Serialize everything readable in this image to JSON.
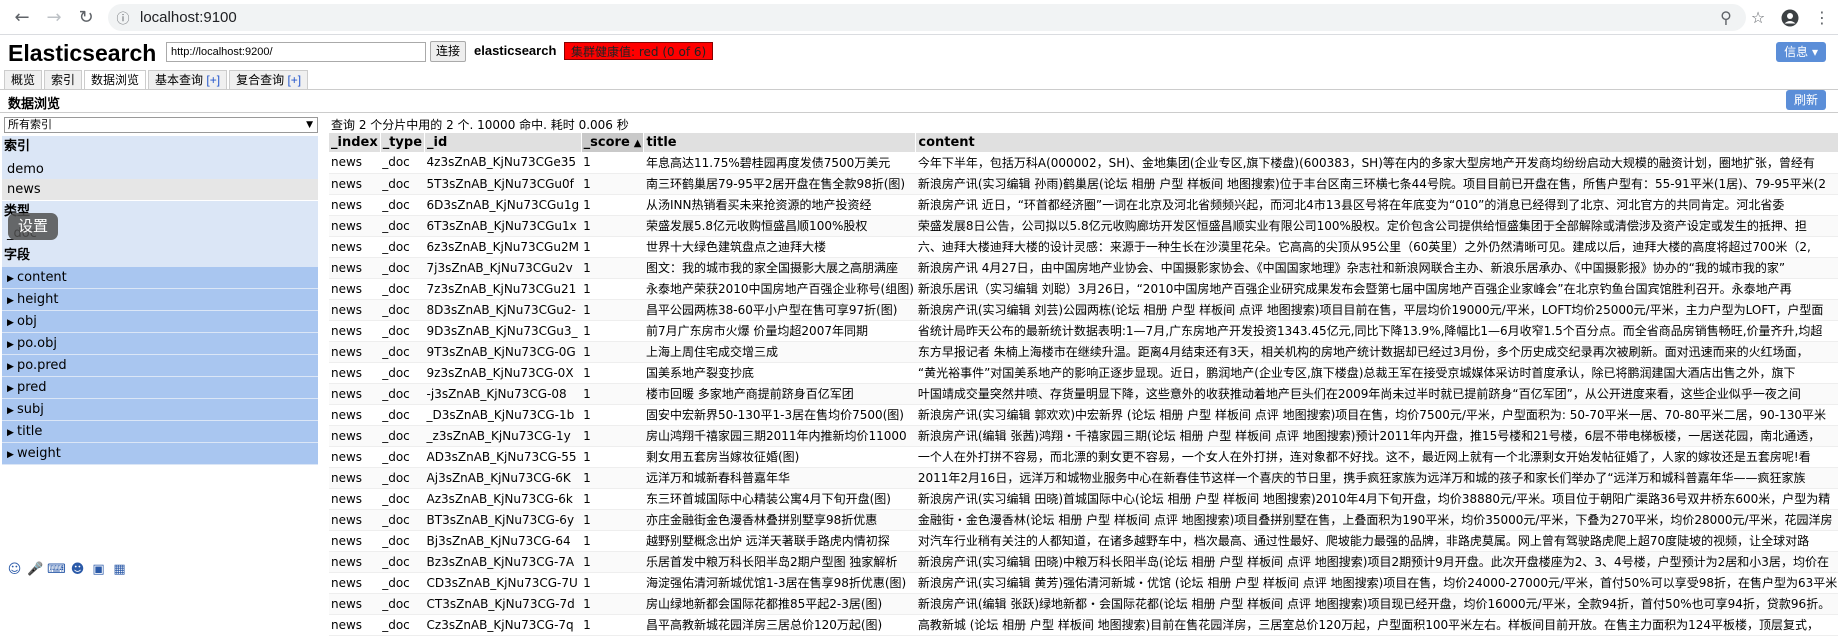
{
  "browser": {
    "url": "localhost:9100"
  },
  "header": {
    "app_title": "Elasticsearch",
    "cluster_url": "http://localhost:9200/",
    "connect_label": "连接",
    "cluster_name": "elasticsearch",
    "health_label": "集群健康值: red (0 of 6)",
    "info_label": "信息 ▾"
  },
  "tabs": [
    {
      "label": "概览",
      "plus": ""
    },
    {
      "label": "索引",
      "plus": ""
    },
    {
      "label": "数据浏览",
      "plus": ""
    },
    {
      "label": "基本查询",
      "plus": "[+]"
    },
    {
      "label": "复合查询",
      "plus": "[+]"
    }
  ],
  "toolbar": {
    "section_title": "数据浏览",
    "refresh_label": "刷新"
  },
  "sidebar": {
    "index_select": "所有索引",
    "index_heading": "索引",
    "indices": [
      "demo",
      "news"
    ],
    "type_heading": "类型",
    "types": [
      "_doc"
    ],
    "field_heading": "字段",
    "fields": [
      "content",
      "height",
      "obj",
      "po.obj",
      "po.pred",
      "pred",
      "subj",
      "title",
      "weight"
    ],
    "tooltip": "设置"
  },
  "results": {
    "summary": "查询 2 个分片中用的 2 个. 10000 命中. 耗时 0.006 秒",
    "columns": [
      "_index",
      "_type",
      "_id",
      "_score",
      "title",
      "content"
    ],
    "rows": [
      [
        "news",
        "_doc",
        "4z3sZnAB_KjNu73CGe35",
        "1",
        "年息高达11.75%碧桂园再度发债7500万美元",
        "今年下半年，包括万科A(000002，SH)、金地集团(企业专区,旗下楼盘)(600383，SH)等在内的多家大型房地产开发商均纷纷启动大规模的融资计划，圈地扩张，曾经有"
      ],
      [
        "news",
        "_doc",
        "5T3sZnAB_KjNu73CGu0f",
        "1",
        "南三环鹤巢居79-95平2居开盘在售全款98折(图)",
        "新浪房产讯(实习编辑 孙雨)鹤巢居(论坛 相册 户型 样板间 地图搜索)位于丰台区南三环横七条44号院。项目目前已开盘在售，所售户型有：55-91平米(1居)、79-95平米(2"
      ],
      [
        "news",
        "_doc",
        "6D3sZnAB_KjNu73CGu1g",
        "1",
        "从汤INN热销看买未来抢资源的地产投资经",
        "新浪房产讯 近日，“环首都经济圈”一词在北京及河北省频频兴起，而河北4市13县区号将在年底变为“010”的消息已经得到了北京、河北官方的共同肯定。河北省委"
      ],
      [
        "news",
        "_doc",
        "6T3sZnAB_KjNu73CGu1x",
        "1",
        "荣盛发展5.8亿元收购恒盛昌顺100%股权",
        "荣盛发展8日公告，公司拟以5.8亿元收购廊坊开发区恒盛昌顺实业有限公司100%股权。定价包含公司提供给恒盛集团于全部解除或清偿涉及资产设定或发生的抵押、担"
      ],
      [
        "news",
        "_doc",
        "6z3sZnAB_KjNu73CGu2M",
        "1",
        "世界十大绿色建筑盘点之迪拜大楼",
        "六、迪拜大楼迪拜大楼的设计灵感：来源于一种生长在沙漠里花朵。它高高的尖顶从95公里（60英里）之外仍然清晰可见。建成以后，迪拜大楼的高度将超过700米（2,"
      ],
      [
        "news",
        "_doc",
        "7j3sZnAB_KjNu73CGu2v",
        "1",
        "图文：我的城市我的家全国摄影大展之高朋满座",
        "新浪房产讯 4月27日，由中国房地产业协会、中国摄影家协会、《中国国家地理》杂志社和新浪网联合主办、新浪乐居承办、《中国摄影报》协办的“我的城市我的家”"
      ],
      [
        "news",
        "_doc",
        "7z3sZnAB_KjNu73CGu21",
        "1",
        "永泰地产荣获2010中国房地产百强企业称号(组图)",
        "新浪乐居讯（实习编辑 刘聪）3月26日，“2010中国房地产百强企业研究成果发布会暨第七届中国房地产百强企业家峰会”在北京钓鱼台国宾馆胜利召开。永泰地产再"
      ],
      [
        "news",
        "_doc",
        "8D3sZnAB_KjNu73CGu2-",
        "1",
        "昌平公园两栋38-60平小户型在售可享97折(图)",
        "新浪房产讯(实习编辑 刘芸)公园两栋(论坛 相册 户型 样板间 点评 地图搜索)项目目前在售，平层均价19000元/平米，LOFT均价25000元/平米，主力户型为LOFT，户型面"
      ],
      [
        "news",
        "_doc",
        "9D3sZnAB_KjNu73CGu3_",
        "1",
        "前7月广东房市火爆 价量均超2007年同期",
        "省统计局昨天公布的最新统计数据表明:1—7月,广东房地产开发投资1343.45亿元,同比下降13.9%,降幅比1—6月收窄1.5个百分点。而全省商品房销售畅旺,价量齐升,均超"
      ],
      [
        "news",
        "_doc",
        "9T3sZnAB_KjNu73CG-0G",
        "1",
        "上海上周住宅成交增三成",
        "东方早报记者 朱楠上海楼市在继续升温。距离4月结束还有3天，相关机构的房地产统计数据却已经过3月份，多个历史成交纪录再次被刷新。面对迅速而来的火红场面，"
      ],
      [
        "news",
        "_doc",
        "9z3sZnAB_KjNu73CG-0X",
        "1",
        "国美系地产裂变抄底",
        "“黄光裕事件”对国美系地产的影响正逐步显现。近日，鹏润地产(企业专区,旗下楼盘)总裁王军在接受京城媒体采访时首度承认，除已将鹏润建国大酒店出售之外，旗下"
      ],
      [
        "news",
        "_doc",
        "-j3sZnAB_KjNu73CG-08",
        "1",
        "楼市回暖 多家地产商提前跻身百亿军团",
        "叶国靖成交量突然井喷、存货量明显下降，这些意外的收获推动着地产巨头们在2009年尚未过半时就已提前跻身“百亿军团”，从公开进度来看，这些企业似乎一夜之间"
      ],
      [
        "news",
        "_doc",
        "_D3sZnAB_KjNu73CG-1b",
        "1",
        "固安中宏新界50-130平1-3居在售均价7500(图)",
        "新浪房产讯(实习编辑 郭欢欢)中宏新界 (论坛 相册 户型 样板间 点评 地图搜索)项目在售，均价7500元/平米，户型面积为: 50-70平米一居、70-80平米二居，90-130平米"
      ],
      [
        "news",
        "_doc",
        "_z3sZnAB_KjNu73CG-1y",
        "1",
        "房山鸿翔千禧家园三期2011年内推新均价11000",
        "新浪房产讯(编辑 张茜)鸿翔・千禧家园三期(论坛 相册 户型 样板间 点评 地图搜索)预计2011年内开盘，推15号楼和21号楼，6层不带电梯板楼，一居送花园，南北通透，"
      ],
      [
        "news",
        "_doc",
        "AD3sZnAB_KjNu73CG-55",
        "1",
        "剩女用五套房当嫁妆征婚(图)",
        "一个人在外打拼不容易，而北漂的剩女更不容易，一个女人在外打拼，连对象都不好找。这不，最近网上就有一个北漂剩女开始发帖征婚了，人家的嫁妆还是五套房呢!看"
      ],
      [
        "news",
        "_doc",
        "Aj3sZnAB_KjNu73CG-6K",
        "1",
        "远洋万和城新春科普嘉年华",
        "2011年2月16日，远洋万和城物业服务中心在新春佳节这样一个喜庆的节日里，携手疯狂家族为远洋万和城的孩子和家长们举办了“远洋万和城科普嘉年华——疯狂家族"
      ],
      [
        "news",
        "_doc",
        "Az3sZnAB_KjNu73CG-6k",
        "1",
        "东三环首城国际中心精装公寓4月下旬开盘(图)",
        "新浪房产讯(实习编辑 田晓)首城国际中心(论坛 相册 户型 样板间 地图搜索)2010年4月下旬开盘，均价38880元/平米。项目位于朝阳广渠路36号双井桥东600米，户型为精"
      ],
      [
        "news",
        "_doc",
        "BT3sZnAB_KjNu73CG-6y",
        "1",
        "亦庄金融街金色漫香林叠拼别墅享98折优惠",
        "金融街・金色漫香林(论坛 相册 户型 样板间 点评 地图搜索)项目叠拼别墅在售，上叠面积为190平米，均价35000元/平米，下叠为270平米，均价28000元/平米，花园洋房"
      ],
      [
        "news",
        "_doc",
        "Bj3sZnAB_KjNu73CG-64",
        "1",
        "越野别墅概念出炉 远洋天著联手路虎内情初探",
        "对汽车行业稍有关注的人都知道，在诸多越野车中，档次最高、通过性最好、爬坡能力最强的品牌，非路虎莫属。网上曾有驾驶路虎爬上超70度陡坡的视频，让全球对路"
      ],
      [
        "news",
        "_doc",
        "Bz3sZnAB_KjNu73CG-7A",
        "1",
        "乐居首发中粮万科长阳半岛2期户型图 独家解析",
        "新浪房产讯(实习编辑 田晓)中粮万科长阳半岛(论坛 相册 户型 样板间 点评 地图搜索)项目2期预计9月开盘。此次开盘楼座为2、3、4号楼，户型预计为2居和小3居，均价在"
      ],
      [
        "news",
        "_doc",
        "CD3sZnAB_KjNu73CG-7U",
        "1",
        "海淀强佑清河新城优馆1-3居在售享98折优惠(图)",
        "新浪房产讯(实习编辑 黄芳)强佑清河新城・优馆 (论坛 相册 户型 样板间 点评 地图搜索)项目在售，均价24000-27000元/平米，首付50%可以享受98折，在售户型为63平米"
      ],
      [
        "news",
        "_doc",
        "CT3sZnAB_KjNu73CG-7d",
        "1",
        "房山绿地新都会国际花都推85平起2-3居(图)",
        "新浪房产讯(编辑 张跃)绿地新都・会国际花都(论坛 相册 户型 样板间 点评 地图搜索)项目现已经开盘，均价16000元/平米，全款94折，首付50%也可享94折，贷款96折。"
      ],
      [
        "news",
        "_doc",
        "Cz3sZnAB_KjNu73CG-7q",
        "1",
        "昌平高教新城花园洋房三居总价120万起(图)",
        "高教新城 (论坛 相册 户型 样板间 地图搜索)目前在售花园洋房，三居室总价120万起，户型面积100平米左右。样板间目前开放。在售主力面积为124平板楼，顶层复式，"
      ]
    ]
  }
}
